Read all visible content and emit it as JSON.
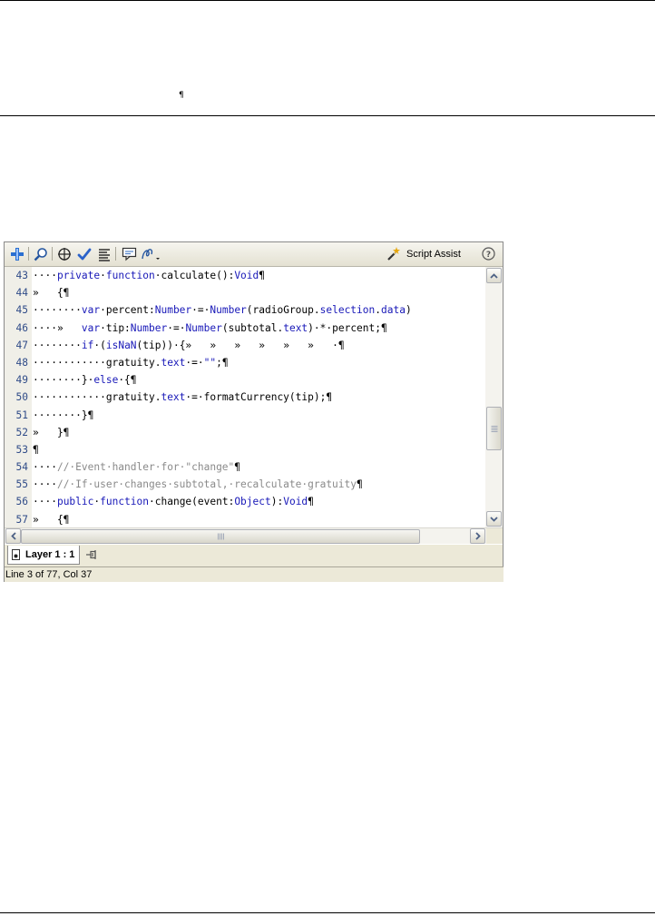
{
  "document": {
    "pilcrow": "¶"
  },
  "toolbar": {
    "icons": [
      "add-item-icon",
      "find-icon",
      "target-icon",
      "check-syntax-icon",
      "auto-format-icon",
      "code-hint-icon",
      "debug-options-icon"
    ],
    "script_assist_label": "Script Assist",
    "help_icon": "help-icon"
  },
  "editor": {
    "lines": [
      {
        "n": "43",
        "segs": [
          [
            "t",
            "····"
          ],
          [
            "k",
            "private"
          ],
          [
            "t",
            "·"
          ],
          [
            "k",
            "function"
          ],
          [
            "t",
            "·calculate():"
          ],
          [
            "k",
            "Void"
          ],
          [
            "t",
            "¶"
          ]
        ]
      },
      {
        "n": "44",
        "segs": [
          [
            "t",
            "»   {¶"
          ]
        ]
      },
      {
        "n": "45",
        "segs": [
          [
            "t",
            "········"
          ],
          [
            "k",
            "var"
          ],
          [
            "t",
            "·percent:"
          ],
          [
            "k",
            "Number"
          ],
          [
            "t",
            "·=·"
          ],
          [
            "k",
            "Number"
          ],
          [
            "t",
            "(radioGroup."
          ],
          [
            "k",
            "selection"
          ],
          [
            "t",
            "."
          ],
          [
            "k",
            "data"
          ],
          [
            "t",
            ")"
          ]
        ]
      },
      {
        "n": "46",
        "segs": [
          [
            "t",
            "····»   "
          ],
          [
            "k",
            "var"
          ],
          [
            "t",
            "·tip:"
          ],
          [
            "k",
            "Number"
          ],
          [
            "t",
            "·=·"
          ],
          [
            "k",
            "Number"
          ],
          [
            "t",
            "(subtotal."
          ],
          [
            "k",
            "text"
          ],
          [
            "t",
            ")·*·percent;¶"
          ]
        ]
      },
      {
        "n": "47",
        "segs": [
          [
            "t",
            "········"
          ],
          [
            "k",
            "if"
          ],
          [
            "t",
            "·("
          ],
          [
            "k",
            "isNaN"
          ],
          [
            "t",
            "(tip))·{»   »   »   »   »   »   ·¶"
          ]
        ]
      },
      {
        "n": "48",
        "segs": [
          [
            "t",
            "············gratuity."
          ],
          [
            "k",
            "text"
          ],
          [
            "t",
            "·=·"
          ],
          [
            "s",
            "\"\""
          ],
          [
            "t",
            ";¶"
          ]
        ]
      },
      {
        "n": "49",
        "segs": [
          [
            "t",
            "········}·"
          ],
          [
            "k",
            "else"
          ],
          [
            "t",
            "·{¶"
          ]
        ]
      },
      {
        "n": "50",
        "segs": [
          [
            "t",
            "············gratuity."
          ],
          [
            "k",
            "text"
          ],
          [
            "t",
            "·=·formatCurrency(tip);¶"
          ]
        ]
      },
      {
        "n": "51",
        "segs": [
          [
            "t",
            "········}¶"
          ]
        ]
      },
      {
        "n": "52",
        "segs": [
          [
            "t",
            "»   }¶"
          ]
        ]
      },
      {
        "n": "53",
        "segs": [
          [
            "t",
            "¶"
          ]
        ]
      },
      {
        "n": "54",
        "segs": [
          [
            "t",
            "····"
          ],
          [
            "c",
            "//·Event·handler·for·\"change\""
          ],
          [
            "t",
            "¶"
          ]
        ]
      },
      {
        "n": "55",
        "segs": [
          [
            "t",
            "····"
          ],
          [
            "c",
            "//·If·user·changes·subtotal,·recalculate·gratuity"
          ],
          [
            "t",
            "¶"
          ]
        ]
      },
      {
        "n": "56",
        "segs": [
          [
            "t",
            "····"
          ],
          [
            "k",
            "public"
          ],
          [
            "t",
            "·"
          ],
          [
            "k",
            "function"
          ],
          [
            "t",
            "·change(event:"
          ],
          [
            "k",
            "Object"
          ],
          [
            "t",
            "):"
          ],
          [
            "k",
            "Void"
          ],
          [
            "t",
            "¶"
          ]
        ]
      },
      {
        "n": "57",
        "segs": [
          [
            "t",
            "»   {¶"
          ]
        ]
      }
    ]
  },
  "tab": {
    "label": "Layer 1 : 1"
  },
  "status": {
    "text": "Line 3 of 77, Col 37"
  },
  "colors": {
    "keyword": "#1818b8",
    "comment": "#8a8a8a",
    "line_number": "#2f4b88",
    "chrome": "#ece9d8"
  }
}
